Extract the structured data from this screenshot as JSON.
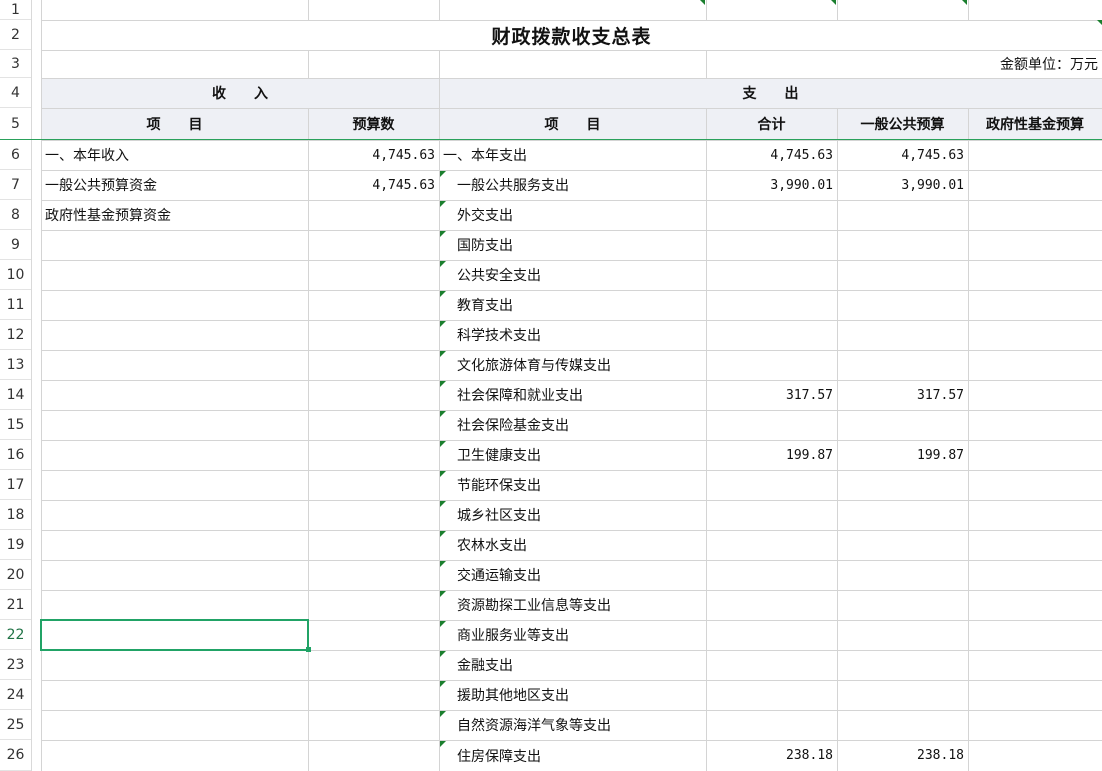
{
  "sheet": {
    "row_numbers": [
      "1",
      "2",
      "3",
      "4",
      "5",
      "6",
      "7",
      "8",
      "9",
      "10",
      "11",
      "12",
      "13",
      "14",
      "15",
      "16",
      "17",
      "18",
      "19",
      "20",
      "21",
      "22",
      "23",
      "24",
      "25",
      "26"
    ],
    "selected_row": "22",
    "title": "财政拨款收支总表",
    "unit": "金额单位：万元",
    "income_header": "收　　入",
    "expense_header": "支　　出",
    "col_income_item": "项　　目",
    "col_income_budget": "预算数",
    "col_expense_item": "项　　目",
    "col_total": "合计",
    "col_general": "一般公共预算",
    "col_fund": "政府性基金预算",
    "income_rows": [
      {
        "item": "一、本年收入",
        "budget": "4,745.63"
      },
      {
        "item": "一般公共预算资金",
        "budget": "4,745.63"
      },
      {
        "item": "政府性基金预算资金",
        "budget": ""
      }
    ],
    "expense_rows": [
      {
        "item": "一、本年支出",
        "total": "4,745.63",
        "general": "4,745.63",
        "fund": ""
      },
      {
        "item": "一般公共服务支出",
        "total": "3,990.01",
        "general": "3,990.01",
        "fund": ""
      },
      {
        "item": "外交支出",
        "total": "",
        "general": "",
        "fund": ""
      },
      {
        "item": "国防支出",
        "total": "",
        "general": "",
        "fund": ""
      },
      {
        "item": "公共安全支出",
        "total": "",
        "general": "",
        "fund": ""
      },
      {
        "item": "教育支出",
        "total": "",
        "general": "",
        "fund": ""
      },
      {
        "item": "科学技术支出",
        "total": "",
        "general": "",
        "fund": ""
      },
      {
        "item": "文化旅游体育与传媒支出",
        "total": "",
        "general": "",
        "fund": ""
      },
      {
        "item": "社会保障和就业支出",
        "total": "317.57",
        "general": "317.57",
        "fund": ""
      },
      {
        "item": "社会保险基金支出",
        "total": "",
        "general": "",
        "fund": ""
      },
      {
        "item": "卫生健康支出",
        "total": "199.87",
        "general": "199.87",
        "fund": ""
      },
      {
        "item": "节能环保支出",
        "total": "",
        "general": "",
        "fund": ""
      },
      {
        "item": "城乡社区支出",
        "total": "",
        "general": "",
        "fund": ""
      },
      {
        "item": "农林水支出",
        "total": "",
        "general": "",
        "fund": ""
      },
      {
        "item": "交通运输支出",
        "total": "",
        "general": "",
        "fund": ""
      },
      {
        "item": "资源勘探工业信息等支出",
        "total": "",
        "general": "",
        "fund": ""
      },
      {
        "item": "商业服务业等支出",
        "total": "",
        "general": "",
        "fund": ""
      },
      {
        "item": "金融支出",
        "total": "",
        "general": "",
        "fund": ""
      },
      {
        "item": "援助其他地区支出",
        "total": "",
        "general": "",
        "fund": ""
      },
      {
        "item": "自然资源海洋气象等支出",
        "total": "",
        "general": "",
        "fund": ""
      },
      {
        "item": "住房保障支出",
        "total": "238.18",
        "general": "238.18",
        "fund": ""
      }
    ]
  }
}
